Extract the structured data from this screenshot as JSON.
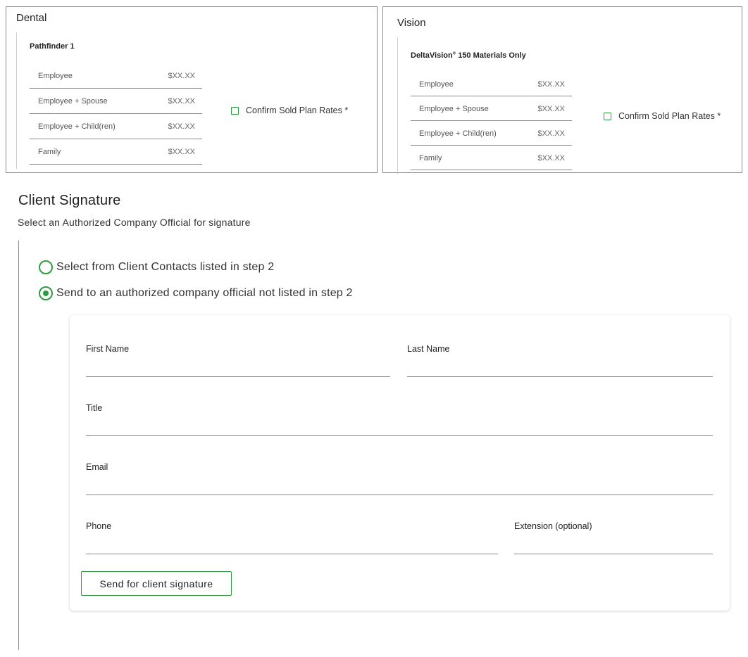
{
  "dental": {
    "title": "Dental",
    "plan_name": "Pathfinder 1",
    "rates": [
      {
        "label": "Employee",
        "value": "$XX.XX"
      },
      {
        "label": "Employee + Spouse",
        "value": "$XX.XX"
      },
      {
        "label": "Employee + Child(ren)",
        "value": "$XX.XX"
      },
      {
        "label": "Family",
        "value": "$XX.XX"
      }
    ],
    "confirm_label": "Confirm Sold Plan Rates *"
  },
  "vision": {
    "title": "Vision",
    "plan_name_main": "DeltaVision",
    "plan_name_mark": "®",
    "plan_name_rest": " 150 Materials Only",
    "rates": [
      {
        "label": "Employee",
        "value": "$XX.XX"
      },
      {
        "label": "Employee + Spouse",
        "value": "$XX.XX"
      },
      {
        "label": "Employee + Child(ren)",
        "value": "$XX.XX"
      },
      {
        "label": "Family",
        "value": "$XX.XX"
      }
    ],
    "confirm_label": "Confirm Sold Plan Rates *"
  },
  "signature": {
    "title": "Client Signature",
    "subtitle": "Select an Authorized Company Official for signature",
    "options": [
      {
        "label": "Select from Client Contacts listed in step 2",
        "selected": false
      },
      {
        "label": "Send to an authorized company official not listed in step 2",
        "selected": true
      }
    ],
    "form": {
      "first_name_label": "First Name",
      "last_name_label": "Last Name",
      "title_label": "Title",
      "email_label": "Email",
      "phone_label": "Phone",
      "extension_label": "Extension (optional)",
      "first_name_value": "",
      "last_name_value": "",
      "title_value": "",
      "email_value": "",
      "phone_value": "",
      "extension_value": ""
    },
    "send_button": "Send for client signature"
  },
  "colors": {
    "accent": "#2e9c3f",
    "border": "#8a8a8a"
  }
}
